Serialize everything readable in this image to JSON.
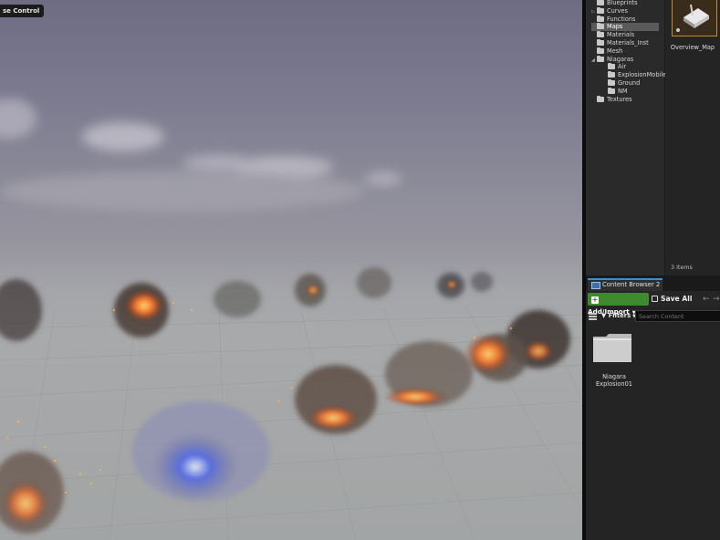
{
  "viewport": {
    "overlay_label": "se Control"
  },
  "folder_tree": {
    "items": [
      {
        "label": "Blueprints",
        "arrow": "",
        "indent": 0,
        "selected": false
      },
      {
        "label": "Curves",
        "arrow": "▷",
        "indent": 0,
        "selected": false
      },
      {
        "label": "Functions",
        "arrow": "",
        "indent": 0,
        "selected": false
      },
      {
        "label": "Maps",
        "arrow": "",
        "indent": 0,
        "selected": true
      },
      {
        "label": "Materials",
        "arrow": "",
        "indent": 0,
        "selected": false
      },
      {
        "label": "Materials_Inst",
        "arrow": "",
        "indent": 0,
        "selected": false
      },
      {
        "label": "Mesh",
        "arrow": "",
        "indent": 0,
        "selected": false
      },
      {
        "label": "Niagaras",
        "arrow": "◢",
        "indent": 0,
        "selected": false
      },
      {
        "label": "Air",
        "arrow": "",
        "indent": 1,
        "selected": false
      },
      {
        "label": "ExplosionMobile",
        "arrow": "",
        "indent": 1,
        "selected": false
      },
      {
        "label": "Ground",
        "arrow": "",
        "indent": 1,
        "selected": false
      },
      {
        "label": "NM",
        "arrow": "",
        "indent": 1,
        "selected": false
      },
      {
        "label": "Textures",
        "arrow": "",
        "indent": 0,
        "selected": false
      }
    ]
  },
  "content_browser_1": {
    "asset_label": "Overview_Map",
    "items_count": "3 items"
  },
  "content_browser_2": {
    "tab_title": "Content Browser 2",
    "add_import_label": "Add/Import",
    "save_all_label": "Save All",
    "filters_label": "Filters",
    "search_placeholder": "Search Content",
    "asset_label": "Niagara\nExplosion01"
  },
  "colors": {
    "add_button": "#3e8a2f",
    "tab_accent": "#3a8fd0",
    "asset_highlight": "#c38b2f"
  }
}
